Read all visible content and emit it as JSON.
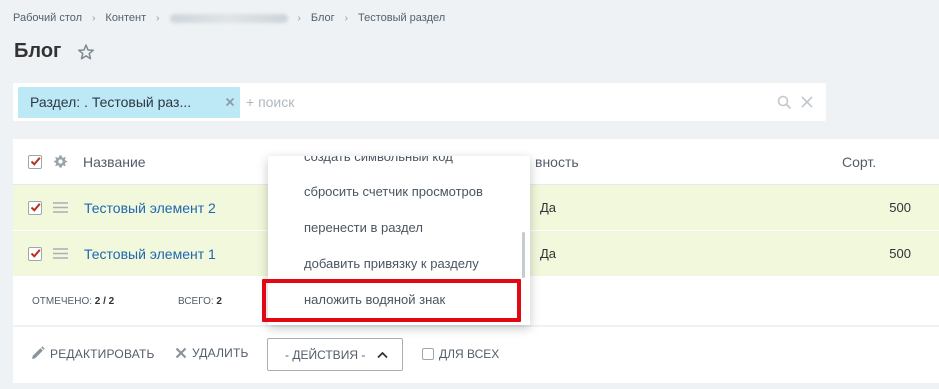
{
  "breadcrumb": {
    "items": [
      "Рабочий стол",
      "Контент",
      "Блог",
      "Тестовый раздел"
    ]
  },
  "page": {
    "title": "Блог"
  },
  "filter": {
    "chip_label": "Раздел: . Тестовый раз...",
    "search_placeholder": "+ поиск"
  },
  "grid": {
    "columns": {
      "name": "Название",
      "active": "вность",
      "sort": "Сорт."
    },
    "rows": [
      {
        "name": "Тестовый элемент 2",
        "active": "Да",
        "sort": "500"
      },
      {
        "name": "Тестовый элемент 1",
        "active": "Да",
        "sort": "500"
      }
    ],
    "footer": {
      "marked_label": "ОТМЕЧЕНО:",
      "marked_value": "2 / 2",
      "total_label": "ВСЕГО:",
      "total_value": "2"
    }
  },
  "actions_menu": {
    "items": [
      "создать символьный код",
      "сбросить счетчик просмотров",
      "перенести в раздел",
      "добавить привязку к разделу",
      "наложить водяной знак"
    ],
    "highlighted_index": 4
  },
  "bottom_panel": {
    "edit_label": "РЕДАКТИРОВАТЬ",
    "delete_label": "УДАЛИТЬ",
    "actions_label": "- ДЕЙСТВИЯ -",
    "for_all_label": "ДЛЯ ВСЕХ"
  },
  "colors": {
    "link": "#2067b0",
    "selected_row": "#f1f8dc",
    "chip": "#bde8f5",
    "highlight": "#e30613",
    "checkbox_check": "#b9311e"
  },
  "icons": [
    "star-icon",
    "chip-close-icon",
    "search-icon",
    "clear-icon",
    "settings-icon",
    "drag-icon",
    "pencil-icon",
    "delete-x-icon",
    "chevron-up-icon",
    "check-icon"
  ]
}
